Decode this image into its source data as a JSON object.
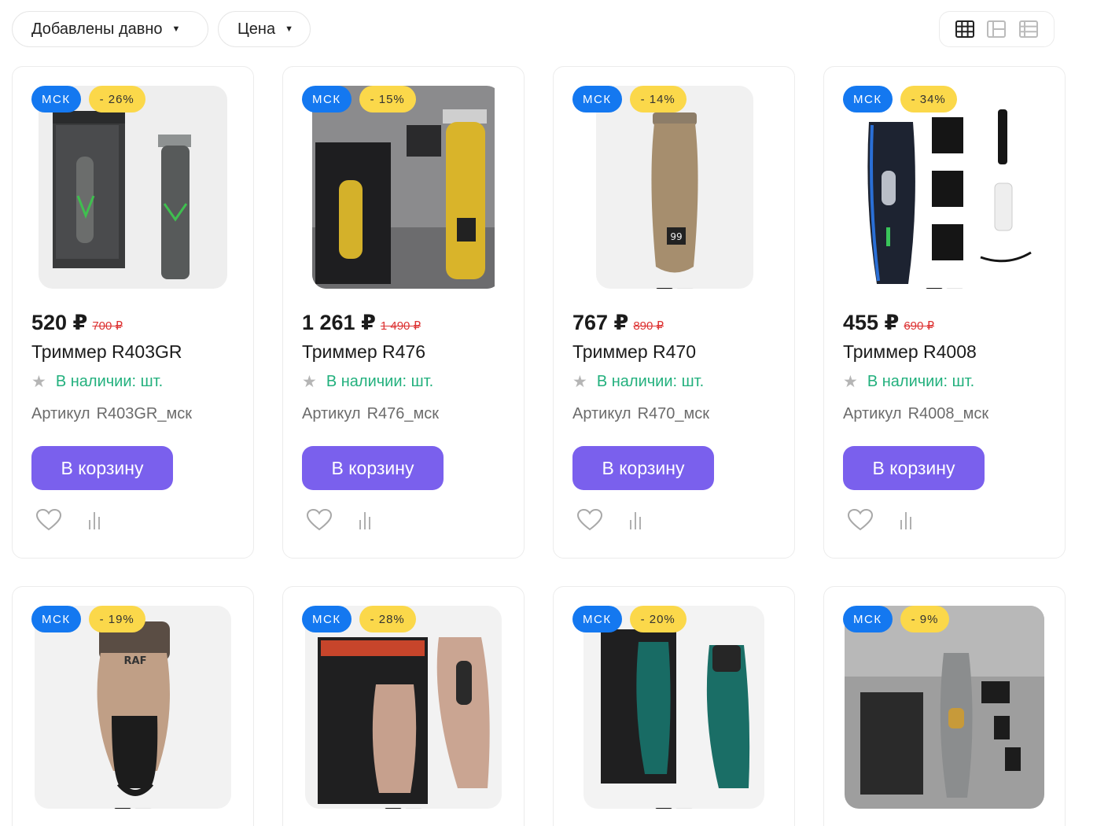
{
  "toolbar": {
    "sort_label": "Добавлены давно",
    "price_label": "Цена",
    "caret": "▼",
    "views": [
      {
        "icon": "grid-view-icon",
        "active": true
      },
      {
        "icon": "list-view-icon",
        "active": false
      },
      {
        "icon": "table-view-icon",
        "active": false
      }
    ]
  },
  "common": {
    "stock_label": "В наличии: шт.",
    "sku_label": "Артикул",
    "cart_label": "В корзину",
    "favorite_icon": "heart-icon",
    "compare_icon": "bar-chart-icon",
    "rating_icon": "star-icon"
  },
  "colors": {
    "accent_button": "#7a60ed",
    "city_badge": "#1478f0",
    "discount_badge": "#fbd84a",
    "in_stock": "#22b07d",
    "old_price": "#d33333"
  },
  "products": [
    {
      "city": "МСК",
      "discount": "- 26%",
      "price": "520 ₽",
      "old_price": "700 ₽",
      "title": "Триммер R403GR",
      "sku": "R403GR_мск"
    },
    {
      "city": "МСК",
      "discount": "- 15%",
      "price": "1 261 ₽",
      "old_price": "1 490 ₽",
      "title": "Триммер R476",
      "sku": "R476_мск"
    },
    {
      "city": "МСК",
      "discount": "- 14%",
      "price": "767 ₽",
      "old_price": "890 ₽",
      "title": "Триммер R470",
      "sku": "R470_мск"
    },
    {
      "city": "МСК",
      "discount": "- 34%",
      "price": "455 ₽",
      "old_price": "690 ₽",
      "title": "Триммер R4008",
      "sku": "R4008_мск"
    },
    {
      "city": "МСК",
      "discount": "- 19%"
    },
    {
      "city": "МСК",
      "discount": "- 28%"
    },
    {
      "city": "МСК",
      "discount": "- 20%"
    },
    {
      "city": "МСК",
      "discount": "- 9%"
    }
  ]
}
